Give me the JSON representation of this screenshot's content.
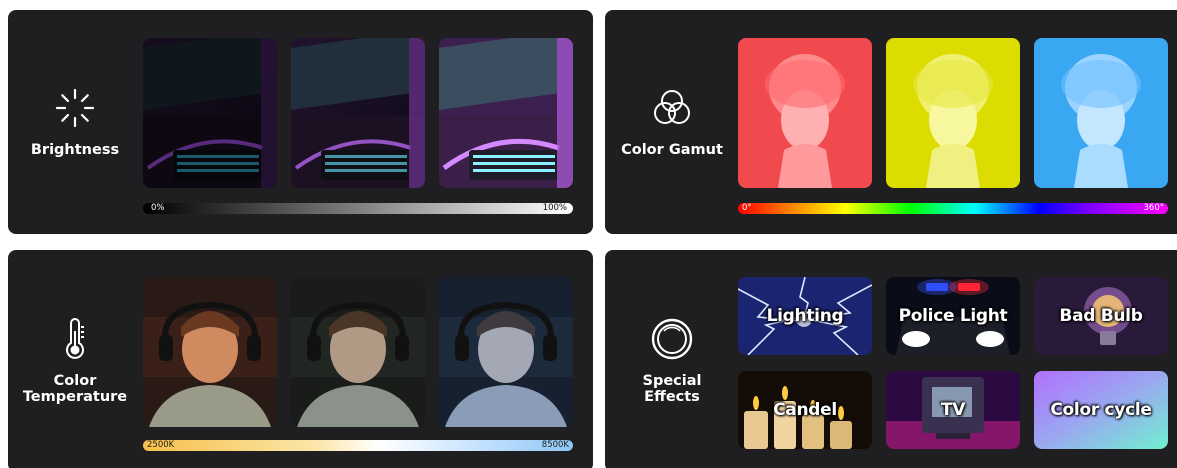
{
  "brightness": {
    "label": "Brightness",
    "icon": "brightness-icon",
    "bar_min": "0%",
    "bar_max": "100%",
    "tile_levels": [
      0.4,
      0.7,
      1.0
    ]
  },
  "gamut": {
    "label": "Color Gamut",
    "icon": "color-circles-icon",
    "bar_min": "0°",
    "bar_max": "360°",
    "tile_colors": [
      "#f0383c",
      "#dfe000",
      "#3aa7f2"
    ]
  },
  "temperature": {
    "label_line1": "Color",
    "label_line2": "Temperature",
    "icon": "thermometer-icon",
    "bar_min": "2500K",
    "bar_max": "8500K",
    "tile_tints": [
      "#b86a3a",
      "#4b5a48",
      "#3d5f8c"
    ]
  },
  "effects": {
    "label_line1": "Special",
    "label_line2": "Effects",
    "icon": "ring-icon",
    "items": [
      {
        "label": "Lighting"
      },
      {
        "label": "Police Light"
      },
      {
        "label": "Bad Bulb"
      },
      {
        "label": "Candel"
      },
      {
        "label": "TV"
      },
      {
        "label": "Color cycle"
      }
    ]
  },
  "colors": {
    "panel_bg": "#1f1f21",
    "text": "#ffffff"
  }
}
